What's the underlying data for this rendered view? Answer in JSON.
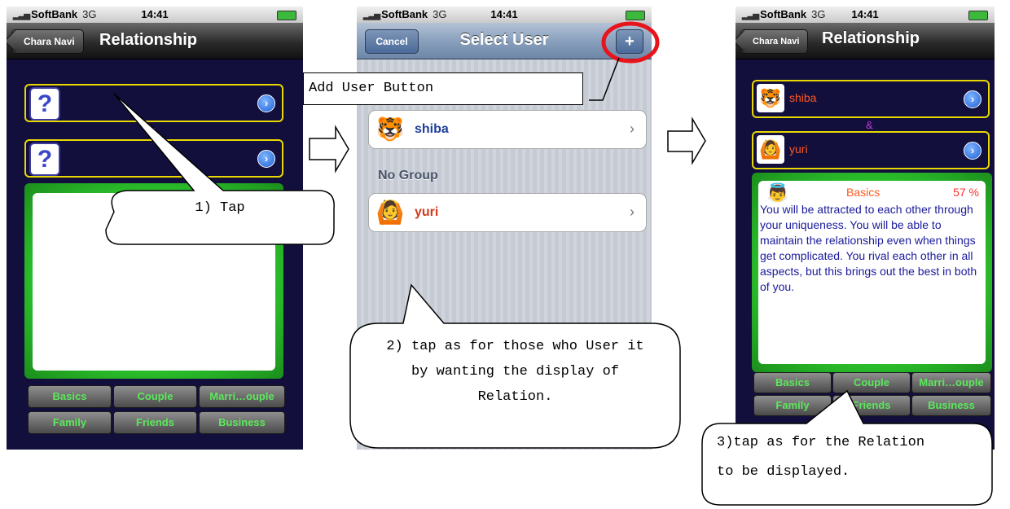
{
  "status": {
    "carrier": "SoftBank",
    "network": "3G",
    "time": "14:41"
  },
  "screen1": {
    "back_label": "Chara Navi",
    "title": "Relationship",
    "amp": "&",
    "qmark": "?",
    "tabs": [
      "Basics",
      "Couple",
      "Marri…ouple",
      "Family",
      "Friends",
      "Business"
    ]
  },
  "screen2": {
    "cancel_label": "Cancel",
    "title": "Select User",
    "add_label": "+",
    "users": [
      {
        "name": "shiba"
      }
    ],
    "group_header": "No Group",
    "group_users": [
      {
        "name": "yuri"
      }
    ]
  },
  "screen3": {
    "back_label": "Chara Navi",
    "title": "Relationship",
    "user1": "shiba",
    "amp": "&",
    "user2": "yuri",
    "section": "Basics",
    "percent": "57 %",
    "description": "You will be attracted to each other through your uniqueness. You will be able to maintain the relationship even when things get complicated.  You rival each other in all aspects, but this brings out the best in both of you.",
    "tabs": [
      "Basics",
      "Couple",
      "Marri…ouple",
      "Family",
      "Friends",
      "Business"
    ]
  },
  "annotations": {
    "tap1": "1) Tap",
    "add_user_label": "Add User Button",
    "tap2_lines": [
      "2) tap as for those who User it",
      "by wanting the display of",
      "Relation."
    ],
    "tap3_lines": [
      "3)tap as for the Relation",
      "to be displayed."
    ]
  },
  "colors": {
    "accent_red": "#e8141b",
    "tab_text": "#5ce85c",
    "user_name_orange": "#ff5a1f",
    "desc_blue": "#1a1a9c"
  }
}
